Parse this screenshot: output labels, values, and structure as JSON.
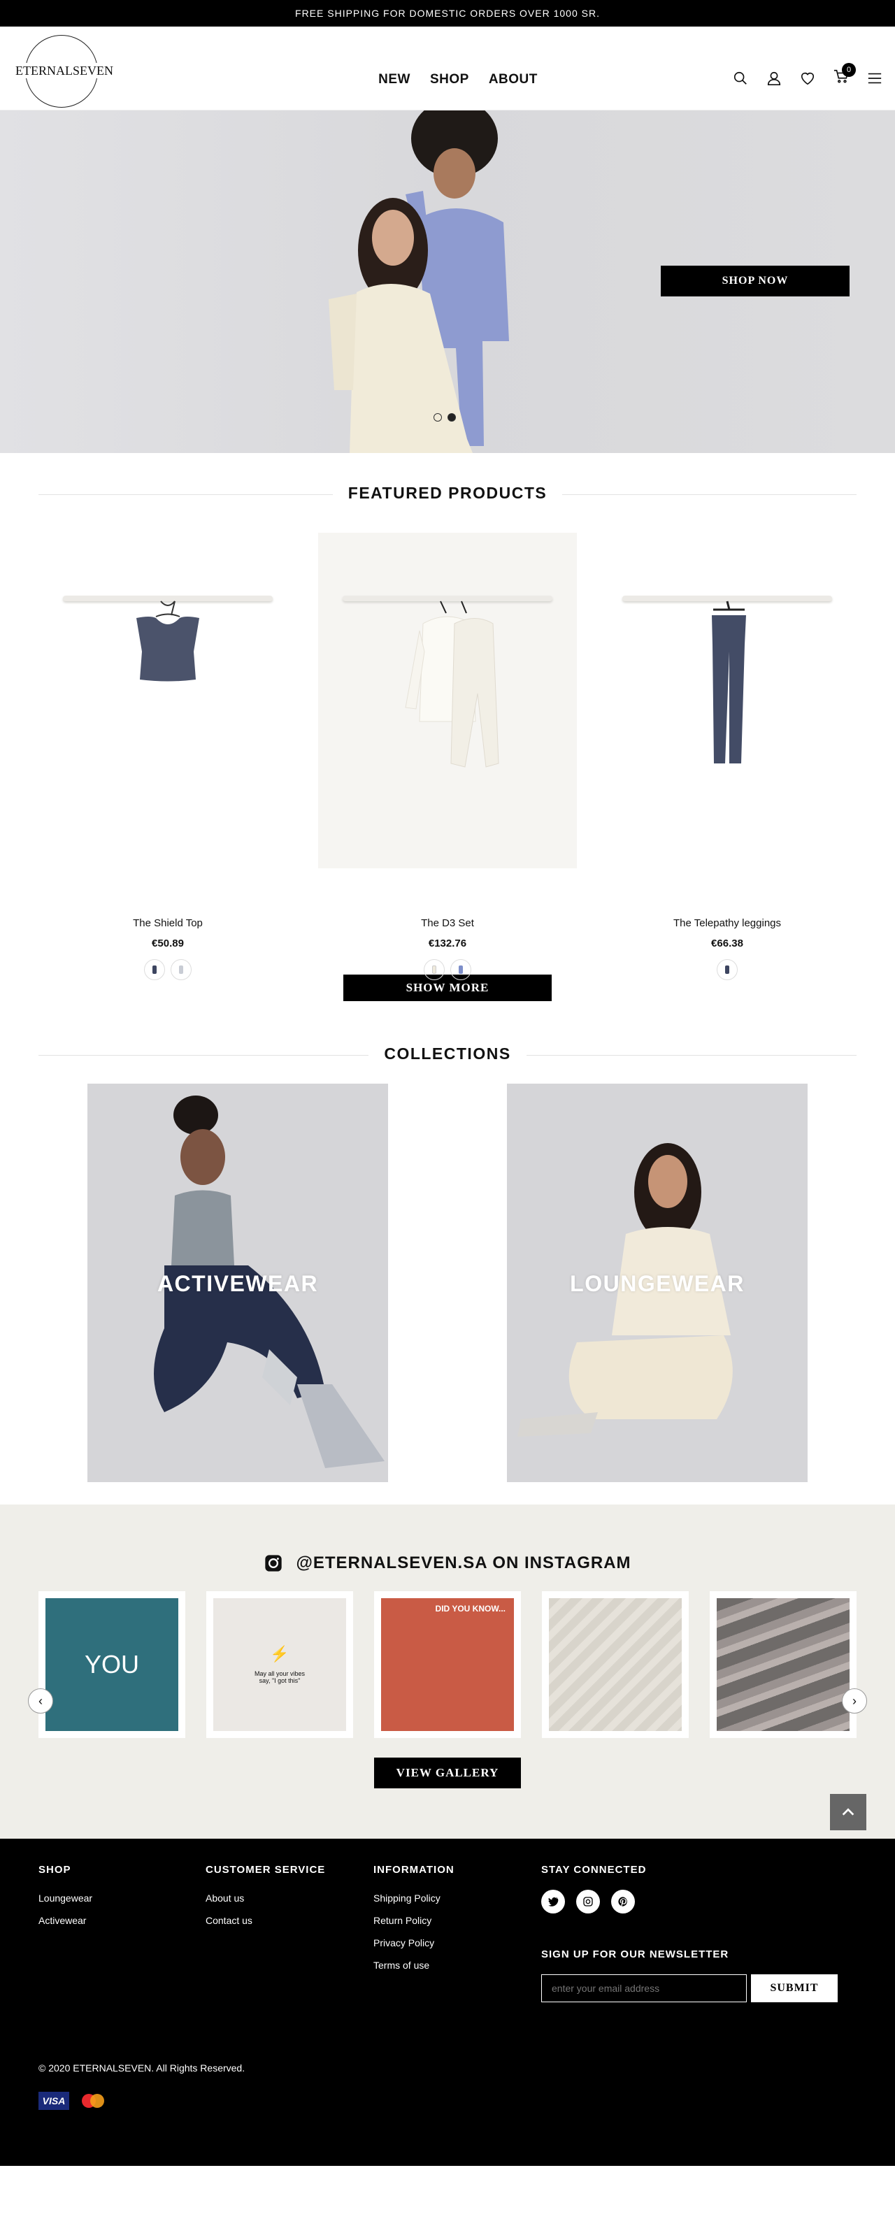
{
  "announcement": "FREE SHIPPING FOR DOMESTIC ORDERS OVER 1000 SR.",
  "brand": {
    "logo_text": "ETERNALSEVEN"
  },
  "nav": [
    "NEW",
    "SHOP",
    "ABOUT"
  ],
  "cart_count": "0",
  "hero": {
    "cta": "SHOP NOW",
    "slides": 2,
    "active_slide": 2
  },
  "featured": {
    "title": "FEATURED PRODUCTS",
    "products": [
      {
        "name": "The Shield Top",
        "price": "€50.89",
        "swatches": [
          "#3d4560",
          "#eceff3"
        ]
      },
      {
        "name": "The D3 Set",
        "price": "€132.76",
        "swatches": [
          "#efeadc",
          "#7d8ec9"
        ]
      },
      {
        "name": "The Telepathy leggings",
        "price": "€66.38",
        "swatches": [
          "#3d4560"
        ]
      }
    ],
    "show_more": "SHOW MORE"
  },
  "collections": {
    "title": "COLLECTIONS",
    "items": [
      "ACTIVEWEAR",
      "LOUNGEWEAR"
    ]
  },
  "instagram": {
    "title": "@ETERNALSEVEN.SA ON INSTAGRAM",
    "tiles": [
      {
        "text": "YOU",
        "bg": "#2f6f7c"
      },
      {
        "text": "May all your vibes say, \"I got this\"",
        "bg": "#ebe8e4"
      },
      {
        "text": "DID YOU KNOW...",
        "bg": "#c95b45"
      },
      {
        "text": "",
        "bg": "#d7d3ca"
      },
      {
        "text": "",
        "bg": "#6f6b69"
      }
    ],
    "cta": "VIEW GALLERY"
  },
  "footer": {
    "shop": {
      "title": "SHOP",
      "links": [
        "Loungewear",
        "Activewear"
      ]
    },
    "service": {
      "title": "CUSTOMER SERVICE",
      "links": [
        "About us",
        "Contact us"
      ]
    },
    "info": {
      "title": "INFORMATION",
      "links": [
        "Shipping Policy",
        "Return Policy",
        "Privacy Policy",
        "Terms of use"
      ]
    },
    "connected": {
      "title": "STAY CONNECTED",
      "social": [
        "twitter-icon",
        "instagram-icon",
        "pinterest-icon"
      ]
    },
    "newsletter": {
      "title": "SIGN UP FOR OUR NEWSLETTER",
      "placeholder": "enter your email address",
      "submit": "SUBMIT"
    },
    "copyright": "© 2020 ETERNALSEVEN. All Rights Reserved.",
    "payments": [
      "VISA",
      "Mastercard"
    ]
  },
  "colors": {
    "accent": "#000000",
    "insta_bg": "#efeee9"
  }
}
